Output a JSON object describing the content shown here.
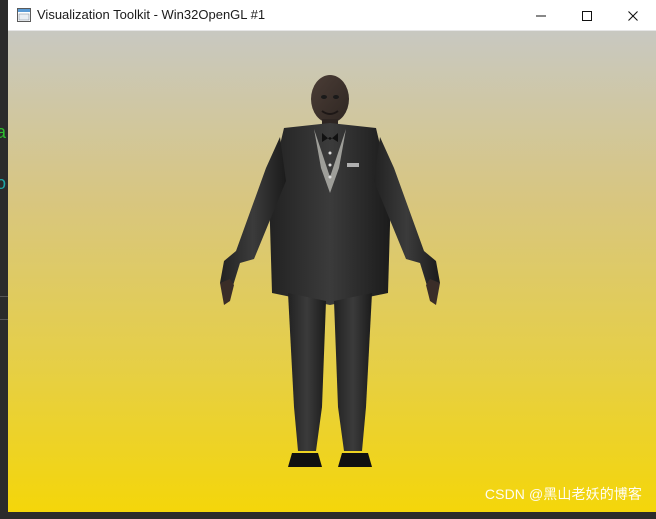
{
  "window": {
    "title": "Visualization Toolkit - Win32OpenGL #1",
    "icons": {
      "app": "window-app-icon",
      "minimize": "minimize-icon",
      "maximize": "maximize-icon",
      "close": "close-icon"
    }
  },
  "background_partial_text": {
    "letter_1": "a",
    "letter_2": "o"
  },
  "scene": {
    "object": "human-character-3d-model",
    "background_gradient": {
      "top": "#c8c8c1",
      "bottom": "#f4d60a"
    }
  },
  "watermark": {
    "text": "CSDN @黑山老妖的博客"
  },
  "colors": {
    "green_text": "#2ebd2e",
    "cyan_text": "#1fa6a6"
  }
}
